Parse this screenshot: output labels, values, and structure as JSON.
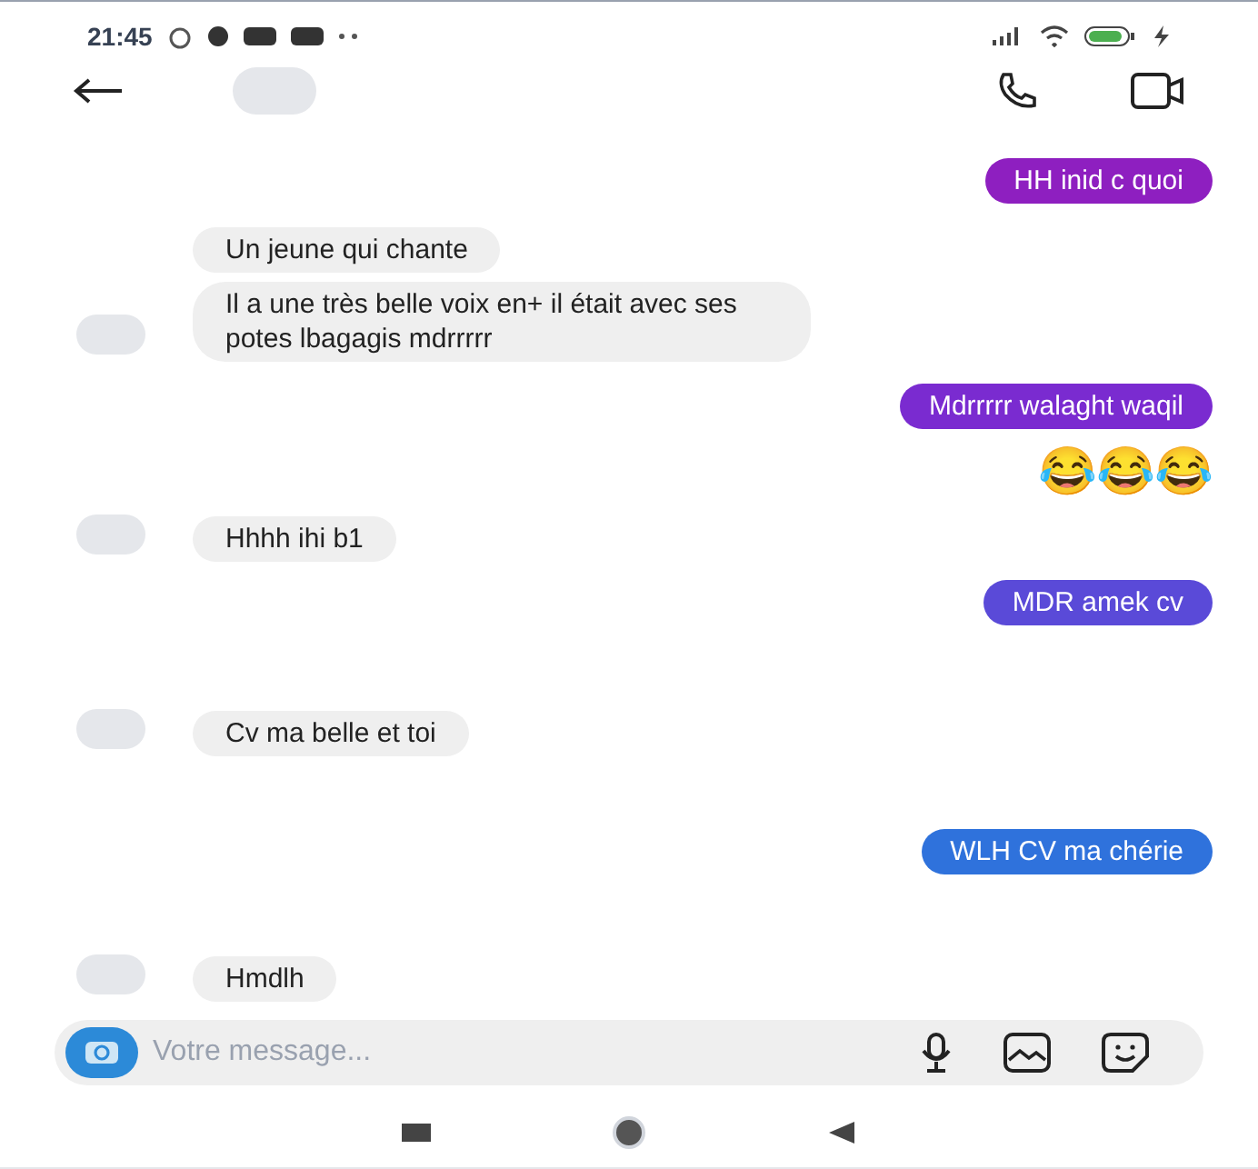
{
  "status_bar": {
    "time": "21:45"
  },
  "messages": [
    {
      "kind": "sent",
      "text": "HH inid c quoi",
      "color": "#8e1fc0"
    },
    {
      "kind": "received",
      "text": "Un jeune qui chante",
      "avatar": false
    },
    {
      "kind": "received",
      "text": "Il a une très belle voix en+ il était avec ses potes lbagagis mdrrrrr",
      "avatar": true
    },
    {
      "kind": "sent",
      "text": "Mdrrrrr walaght waqil",
      "color": "#7a2bd0"
    },
    {
      "kind": "emoji",
      "text": "😂😂😂"
    },
    {
      "kind": "received",
      "text": "Hhhh ihi b1",
      "avatar": true
    },
    {
      "kind": "sent",
      "text": "MDR amek cv",
      "color": "#5a4ad8"
    },
    {
      "kind": "received",
      "text": "Cv ma belle et toi",
      "avatar": true
    },
    {
      "kind": "sent",
      "text": "WLH CV ma chérie",
      "color": "#2f72dc"
    },
    {
      "kind": "received",
      "text": "Hmdlh",
      "avatar": true
    }
  ],
  "composer": {
    "placeholder": "Votre message..."
  }
}
